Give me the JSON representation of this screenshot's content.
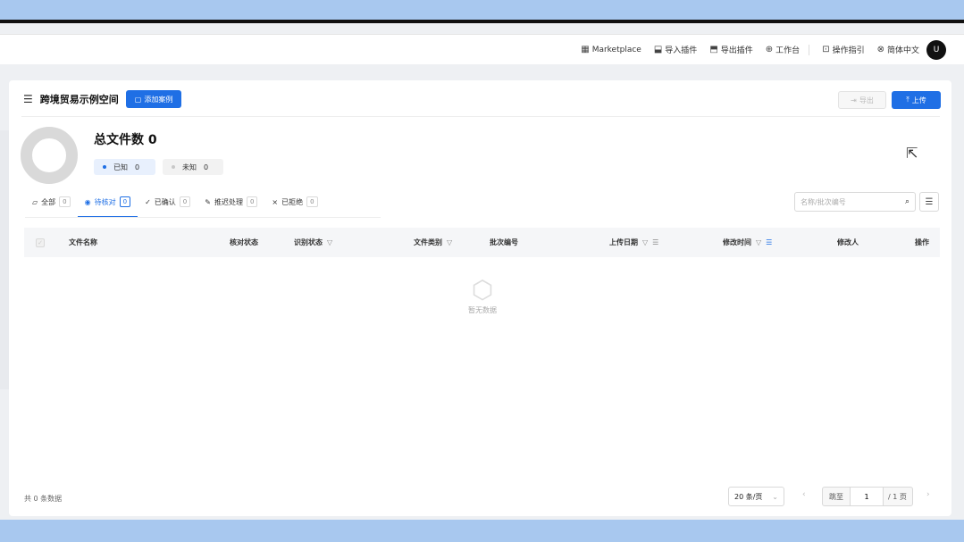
{
  "nav": {
    "items": [
      {
        "icon": "calendar-icon",
        "label": "Marketplace"
      },
      {
        "icon": "import-plugin-icon",
        "label": "导入插件"
      },
      {
        "icon": "export-plugin-icon",
        "label": "导出插件"
      },
      {
        "icon": "workbench-icon",
        "label": "工作台"
      },
      {
        "icon": "guide-icon",
        "label": "操作指引"
      },
      {
        "icon": "globe-icon",
        "label": "简体中文"
      }
    ],
    "avatar": "U"
  },
  "workspace": {
    "title": "跨境贸易示例空间",
    "add_label": "添加案例",
    "export_label": "导出",
    "upload_label": "上传"
  },
  "summary": {
    "total_label": "总文件数",
    "total_value": "0",
    "known_label": "已知",
    "known_count": "0",
    "unknown_label": "未知",
    "unknown_count": "0"
  },
  "tabs": [
    {
      "label": "全部",
      "count": "0",
      "icon": "folder-icon"
    },
    {
      "label": "待核对",
      "count": "0",
      "icon": "eye-icon"
    },
    {
      "label": "已确认",
      "count": "0",
      "icon": "check-icon"
    },
    {
      "label": "推迟处理",
      "count": "0",
      "icon": "pen-icon"
    },
    {
      "label": "已拒绝",
      "count": "0",
      "icon": "close-icon"
    }
  ],
  "search": {
    "placeholder": "名称/批次编号"
  },
  "table": {
    "columns": [
      "文件名称",
      "核对状态",
      "识别状态",
      "文件类别",
      "批次编号",
      "上传日期",
      "修改时间",
      "修改人",
      "操作"
    ],
    "empty_text": "暂无数据"
  },
  "footer": {
    "count_text": "共 0 条数据",
    "page_size": "20 条/页",
    "goto_label": "跳至",
    "page_value": "1",
    "page_total": "/ 1 页"
  },
  "colors": {
    "primary": "#1f6fe5",
    "donut": "#d9d9d9"
  }
}
